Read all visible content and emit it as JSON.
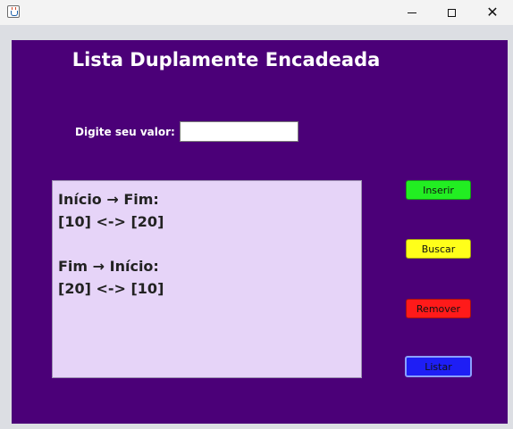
{
  "window": {
    "title": "",
    "controls": {
      "minimize": "minimize-icon",
      "maximize": "maximize-icon",
      "close": "close-icon"
    },
    "close_glyph": "✕"
  },
  "app": {
    "heading": "Lista Duplamente Encadeada",
    "input": {
      "label": "Digite seu valor:",
      "value": "",
      "placeholder": ""
    },
    "output": {
      "lines": [
        "Início → Fim:",
        "[10] <-> [20]",
        "",
        "Fim → Início:",
        "[20] <-> [10]"
      ]
    },
    "buttons": {
      "inserir": "Inserir",
      "buscar": "Buscar",
      "remover": "Remover",
      "listar": "Listar"
    },
    "colors": {
      "panel": "#4b0078",
      "output_bg": "#e6d4f8",
      "inserir": "#22ee22",
      "buscar": "#ffff1a",
      "remover": "#ff1a1a",
      "listar": "#1e1ef5"
    }
  }
}
